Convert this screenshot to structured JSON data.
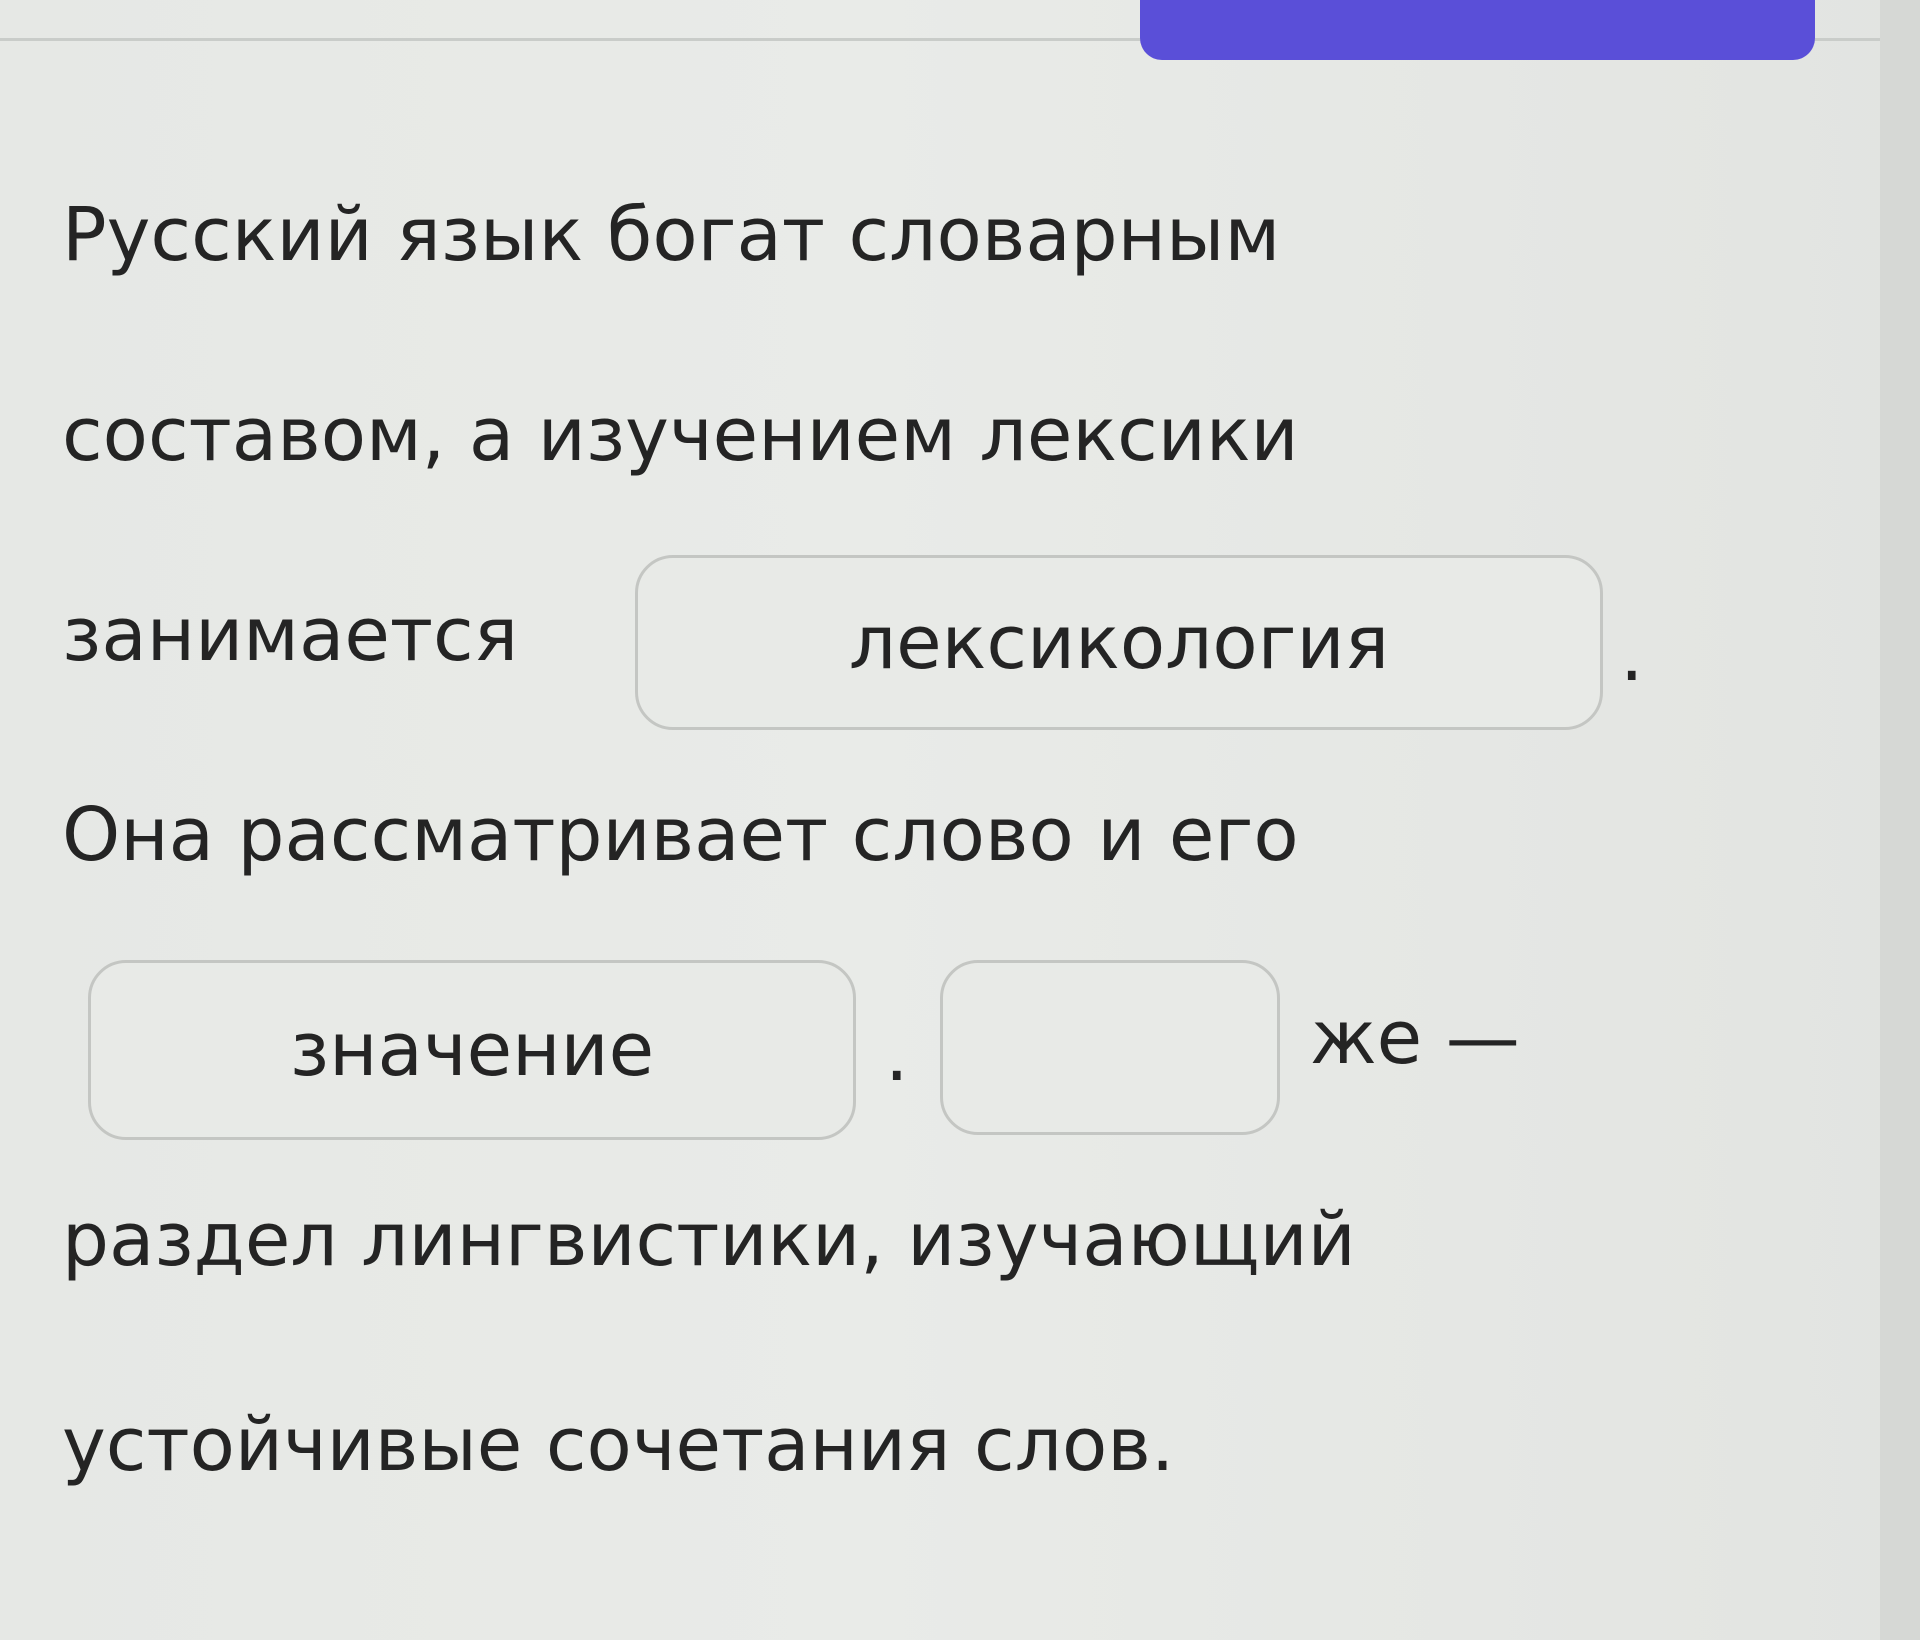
{
  "exercise": {
    "line1": "Русский язык богат словарным",
    "line2": "составом, а изучением лексики",
    "line3_prefix": "занимается",
    "blank1_value": "лексикология",
    "line3_suffix": ".",
    "line4": "Она рассматривает слово и его",
    "blank2_value": "значение",
    "line5_dot": ".",
    "blank3_value": "",
    "line5_suffix": "же —",
    "line6": "раздел лингвистики, изучающий",
    "line7": "устойчивые сочетания слов."
  },
  "colors": {
    "accent": "#5a4fd8",
    "background": "#e6e8e5",
    "text": "#242424",
    "box_border": "#c4c6c3"
  },
  "icons": {
    "top_button_icon": "cart-icon"
  }
}
